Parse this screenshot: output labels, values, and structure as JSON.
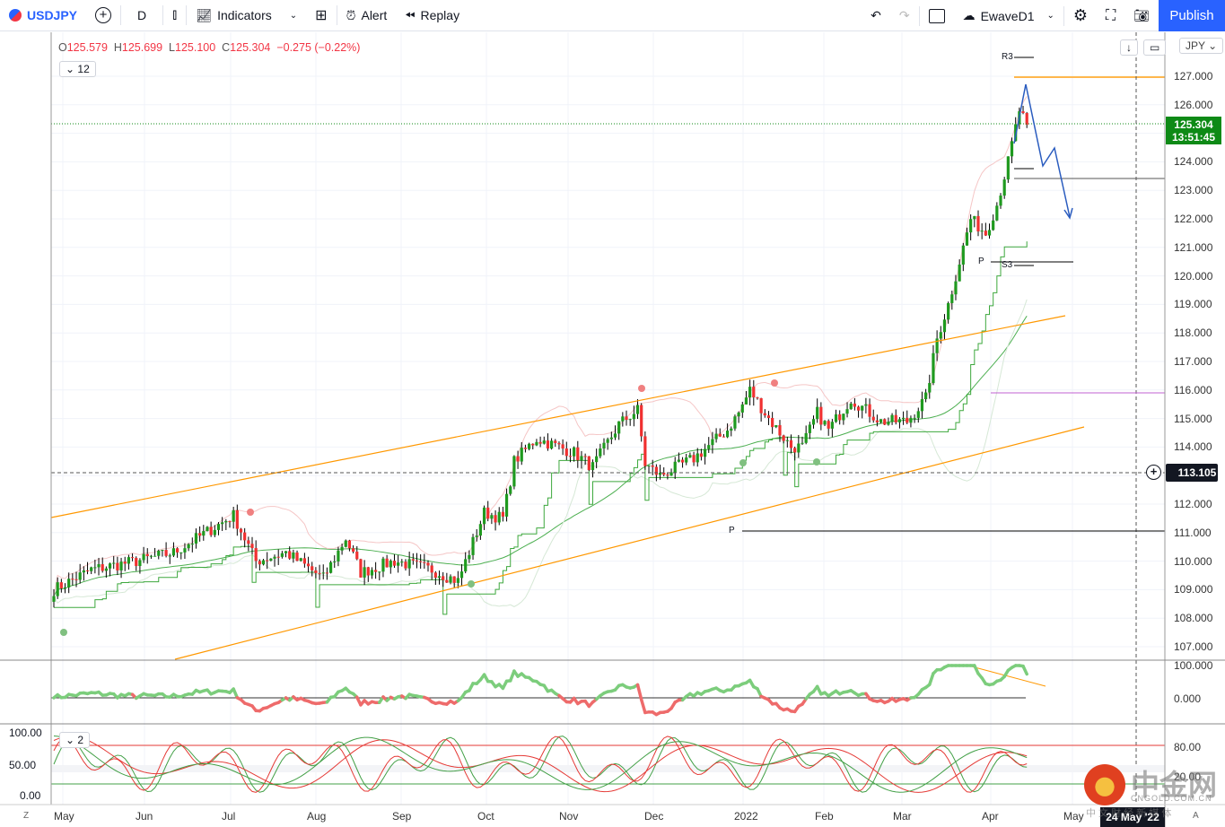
{
  "toolbar": {
    "symbol": "USDJPY",
    "interval": "D",
    "indicators": "Indicators",
    "alert": "Alert",
    "replay": "Replay",
    "layout_name": "EwaveD1",
    "publish": "Publish"
  },
  "legend": {
    "o_key": "O",
    "o": "125.579",
    "h_key": "H",
    "h": "125.699",
    "l_key": "L",
    "l": "125.100",
    "c_key": "C",
    "c": "125.304",
    "change": "−0.275 (−0.22%)",
    "collapsed_count": "12",
    "pane3_count": "2"
  },
  "currency": "JPY",
  "price_axis": [
    "127.000",
    "126.000",
    "125.000",
    "124.000",
    "123.000",
    "122.000",
    "121.000",
    "120.000",
    "119.000",
    "118.000",
    "117.000",
    "116.000",
    "115.000",
    "114.000",
    "113.000",
    "112.000",
    "111.000",
    "110.000",
    "109.000",
    "108.000",
    "107.000"
  ],
  "last_price": {
    "price": "125.304",
    "countdown": "13:51:45"
  },
  "crosshair_price": "113.105",
  "osc1_axis": [
    "100.000",
    "0.000"
  ],
  "osc2_axis_right": [
    "80.00",
    "20.00"
  ],
  "osc2_axis_left": [
    "100.00",
    "50.00",
    "0.00"
  ],
  "time_axis": [
    "May",
    "Jun",
    "Jul",
    "Aug",
    "Sep",
    "Oct",
    "Nov",
    "Dec",
    "2022",
    "Feb",
    "Mar",
    "Apr",
    "May"
  ],
  "crosshair_date": "24 May '22",
  "pivot_labels": {
    "r3": "R3",
    "p_top": "P",
    "s3": "S3",
    "p_mid": "P"
  },
  "bottom": {
    "z": "Z",
    "a": "A"
  },
  "watermark": {
    "brand": "中金网",
    "domain": "CNGOLD.COM.CN",
    "tagline": "中 文 财 经 新 媒 体"
  },
  "colors": {
    "up": "#1f9a1f",
    "down": "#f03030",
    "accent": "#2962ff",
    "channel": "#ff9800",
    "projection": "#2a5cbf"
  },
  "chart_data": {
    "type": "candlestick",
    "symbol": "USDJPY",
    "bars": 261,
    "close_keypoints": [
      [
        0,
        109.0
      ],
      [
        10,
        109.7
      ],
      [
        22,
        110.0
      ],
      [
        32,
        110.3
      ],
      [
        48,
        111.6
      ],
      [
        54,
        110.0
      ],
      [
        62,
        110.3
      ],
      [
        72,
        109.4
      ],
      [
        78,
        110.8
      ],
      [
        82,
        109.6
      ],
      [
        91,
        110.0
      ],
      [
        101,
        109.7
      ],
      [
        108,
        109.3
      ],
      [
        115,
        111.7
      ],
      [
        120,
        111.5
      ],
      [
        123,
        113.5
      ],
      [
        129,
        114.3
      ],
      [
        139,
        113.8
      ],
      [
        144,
        113.3
      ],
      [
        151,
        114.8
      ],
      [
        156,
        115.3
      ],
      [
        158,
        113.4
      ],
      [
        162,
        113.0
      ],
      [
        171,
        113.6
      ],
      [
        180,
        114.6
      ],
      [
        183,
        115.2
      ],
      [
        186,
        116.0
      ],
      [
        191,
        115.0
      ],
      [
        197,
        114.0
      ],
      [
        200,
        114.0
      ],
      [
        204,
        115.2
      ],
      [
        207,
        114.6
      ],
      [
        213,
        115.7
      ],
      [
        221,
        114.9
      ],
      [
        228,
        114.9
      ],
      [
        233,
        115.7
      ],
      [
        236,
        117.8
      ],
      [
        239,
        119.0
      ],
      [
        243,
        121.0
      ],
      [
        245,
        122.0
      ],
      [
        249,
        121.5
      ],
      [
        252,
        122.5
      ],
      [
        255,
        124.0
      ],
      [
        258,
        125.8
      ],
      [
        260,
        125.3
      ]
    ],
    "ylim": [
      106.5,
      128.5
    ]
  }
}
